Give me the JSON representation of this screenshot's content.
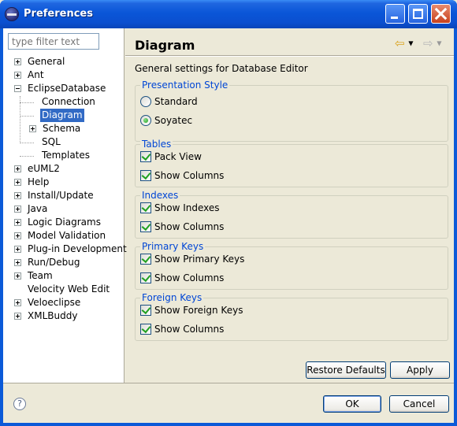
{
  "window": {
    "title": "Preferences"
  },
  "filter": {
    "placeholder": "type filter text"
  },
  "tree": [
    {
      "label": "General",
      "expander": "plus"
    },
    {
      "label": "Ant",
      "expander": "plus"
    },
    {
      "label": "EclipseDatabase",
      "expander": "minus"
    },
    {
      "label": "Connection",
      "expander": "none"
    },
    {
      "label": "Diagram",
      "expander": "none",
      "selected": true
    },
    {
      "label": "Schema",
      "expander": "plus"
    },
    {
      "label": "SQL",
      "expander": "none"
    },
    {
      "label": "Templates",
      "expander": "none"
    },
    {
      "label": "eUML2",
      "expander": "plus"
    },
    {
      "label": "Help",
      "expander": "plus"
    },
    {
      "label": "Install/Update",
      "expander": "plus"
    },
    {
      "label": "Java",
      "expander": "plus"
    },
    {
      "label": "Logic Diagrams",
      "expander": "plus"
    },
    {
      "label": "Model Validation",
      "expander": "plus"
    },
    {
      "label": "Plug-in Development",
      "expander": "plus"
    },
    {
      "label": "Run/Debug",
      "expander": "plus"
    },
    {
      "label": "Team",
      "expander": "plus"
    },
    {
      "label": "Velocity Web Edit",
      "expander": "none"
    },
    {
      "label": "Veloeclipse",
      "expander": "plus"
    },
    {
      "label": "XMLBuddy",
      "expander": "plus"
    }
  ],
  "page": {
    "title": "Diagram",
    "description": "General settings for Database Editor",
    "back_icon": "back-arrow-icon",
    "forward_icon": "forward-arrow-icon"
  },
  "groups": {
    "presentation": {
      "title": "Presentation Style",
      "standard": "Standard",
      "soyatec": "Soyatec",
      "selected": "Soyatec"
    },
    "tables": {
      "title": "Tables",
      "opt1": "Pack View",
      "opt2": "Show Columns"
    },
    "indexes": {
      "title": "Indexes",
      "opt1": "Show Indexes",
      "opt2": "Show Columns"
    },
    "primary": {
      "title": "Primary Keys",
      "opt1": "Show Primary Keys",
      "opt2": "Show Columns"
    },
    "foreign": {
      "title": "Foreign Keys",
      "opt1": "Show Foreign Keys",
      "opt2": "Show Columns"
    }
  },
  "buttons": {
    "restore": "Restore Defaults",
    "apply": "Apply",
    "ok": "OK",
    "cancel": "Cancel",
    "help": "?"
  },
  "colors": {
    "titlebar": "#0a56d8",
    "group_title": "#0046d5",
    "selection": "#316ac5",
    "check": "#21a121"
  }
}
